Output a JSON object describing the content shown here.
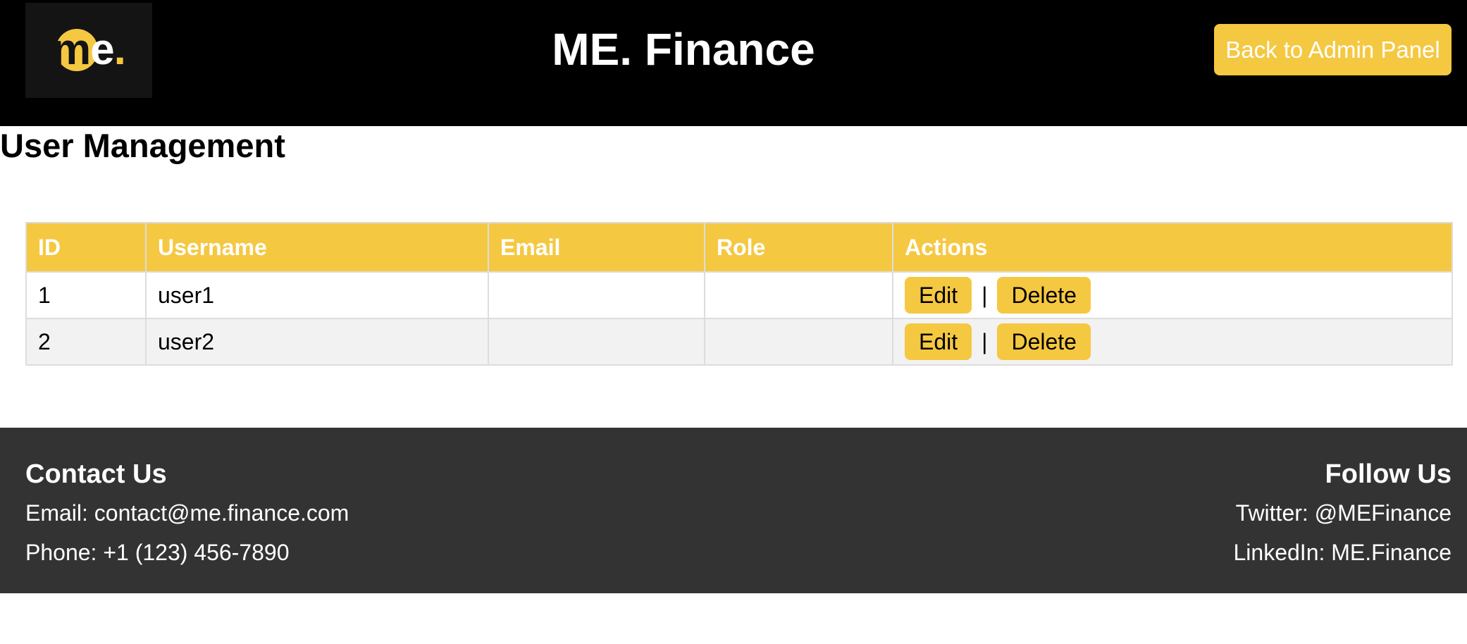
{
  "header": {
    "logo_text_m": "m",
    "logo_text_e": "e",
    "logo_text_dot": ".",
    "title": "ME. Finance",
    "back_button": "Back to Admin Panel"
  },
  "page": {
    "heading": "User Management"
  },
  "table": {
    "columns": [
      "ID",
      "Username",
      "Email",
      "Role",
      "Actions"
    ],
    "rows": [
      {
        "id": "1",
        "username": "user1",
        "email": "",
        "role": ""
      },
      {
        "id": "2",
        "username": "user2",
        "email": "",
        "role": ""
      }
    ],
    "edit_label": "Edit",
    "separator": "|",
    "delete_label": "Delete"
  },
  "footer": {
    "contact": {
      "heading": "Contact Us",
      "email": "Email: contact@me.finance.com",
      "phone": "Phone: +1 (123) 456-7890"
    },
    "follow": {
      "heading": "Follow Us",
      "twitter": "Twitter: @MEFinance",
      "linkedin": "LinkedIn: ME.Finance"
    }
  },
  "colors": {
    "accent": "#f5c842",
    "header_bg": "#000000",
    "footer_bg": "#333333",
    "row_alt_bg": "#f2f2f2"
  }
}
